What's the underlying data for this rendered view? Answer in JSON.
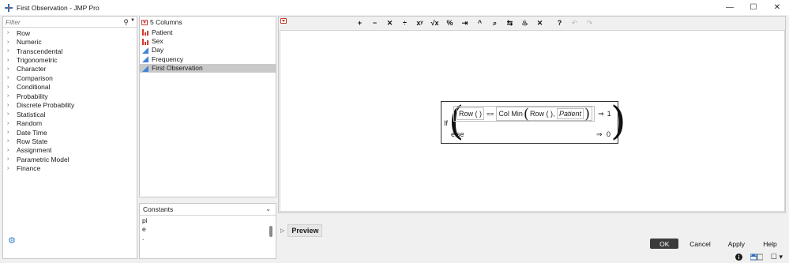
{
  "window": {
    "title": "First Observation - JMP Pro",
    "controls": {
      "minimize": "—",
      "maximize": "☐",
      "close": "✕"
    }
  },
  "filter": {
    "placeholder": "Filter"
  },
  "categories": [
    "Row",
    "Numeric",
    "Transcendental",
    "Trigonometric",
    "Character",
    "Comparison",
    "Conditional",
    "Probability",
    "Discrete Probability",
    "Statistical",
    "Random",
    "Date Time",
    "Row State",
    "Assignment",
    "Parametric Model",
    "Finance"
  ],
  "columns": {
    "header": "5 Columns",
    "items": [
      {
        "label": "Patient",
        "icon": "nominal-bar-icon"
      },
      {
        "label": "Sex",
        "icon": "nominal-bar-icon"
      },
      {
        "label": "Day",
        "icon": "continuous-triangle-icon"
      },
      {
        "label": "Frequency",
        "icon": "continuous-triangle-icon"
      },
      {
        "label": "First Observation",
        "icon": "continuous-triangle-icon",
        "selected": true
      }
    ]
  },
  "constants": {
    "header": "Constants",
    "items": [
      "pi",
      "e",
      "."
    ]
  },
  "toolbar": {
    "buttons": [
      "+",
      "−",
      "✕",
      "÷",
      "xʸ",
      "√x",
      "%",
      "⇥",
      "^",
      "⌕",
      "⇆",
      "♨",
      "✕",
      "?",
      "↶",
      "↷"
    ]
  },
  "formula": {
    "if": "If",
    "row": "Row",
    "paren_open": "(",
    "paren_close": ")",
    "eq": "==",
    "col_min": "Col Min",
    "comma": ",",
    "patient": "Patient",
    "then_value": "1",
    "else": "else",
    "else_value": "0",
    "arrow": "⇒"
  },
  "preview": {
    "label": "Preview"
  },
  "buttons": {
    "ok": "OK",
    "cancel": "Cancel",
    "apply": "Apply",
    "help": "Help"
  }
}
